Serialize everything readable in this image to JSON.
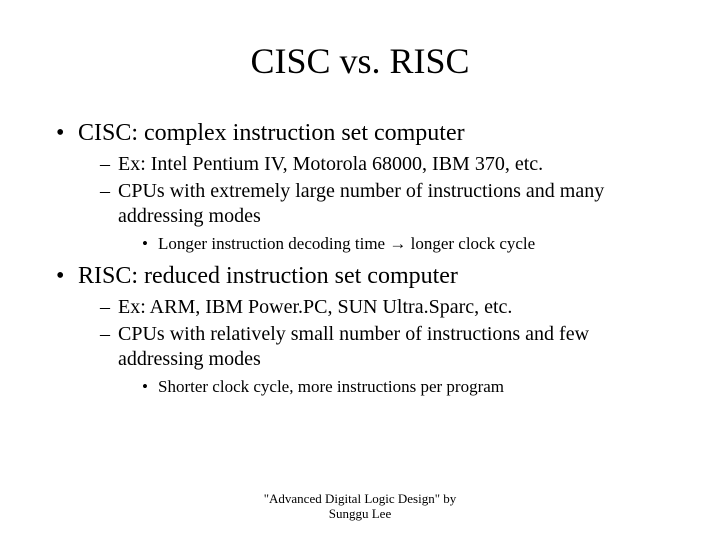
{
  "title": "CISC vs. RISC",
  "bullets": [
    {
      "text": "CISC: complex instruction set computer",
      "sub": [
        {
          "text": "Ex: Intel Pentium IV, Motorola 68000, IBM 370, etc."
        },
        {
          "text": "CPUs with extremely large number of instructions and many addressing modes",
          "sub": [
            {
              "prefix": "Longer instruction decoding time ",
              "arrow": "→",
              "suffix": " longer clock cycle"
            }
          ]
        }
      ]
    },
    {
      "text": "RISC: reduced instruction set computer",
      "sub": [
        {
          "text": "Ex: ARM, IBM Power.PC, SUN Ultra.Sparc, etc."
        },
        {
          "text": "CPUs with relatively small number of  instructions and few addressing modes",
          "sub": [
            {
              "text": "Shorter clock cycle, more instructions per program"
            }
          ]
        }
      ]
    }
  ],
  "footer": {
    "line1": "\"Advanced Digital Logic Design\" by",
    "line2": "Sunggu Lee"
  }
}
